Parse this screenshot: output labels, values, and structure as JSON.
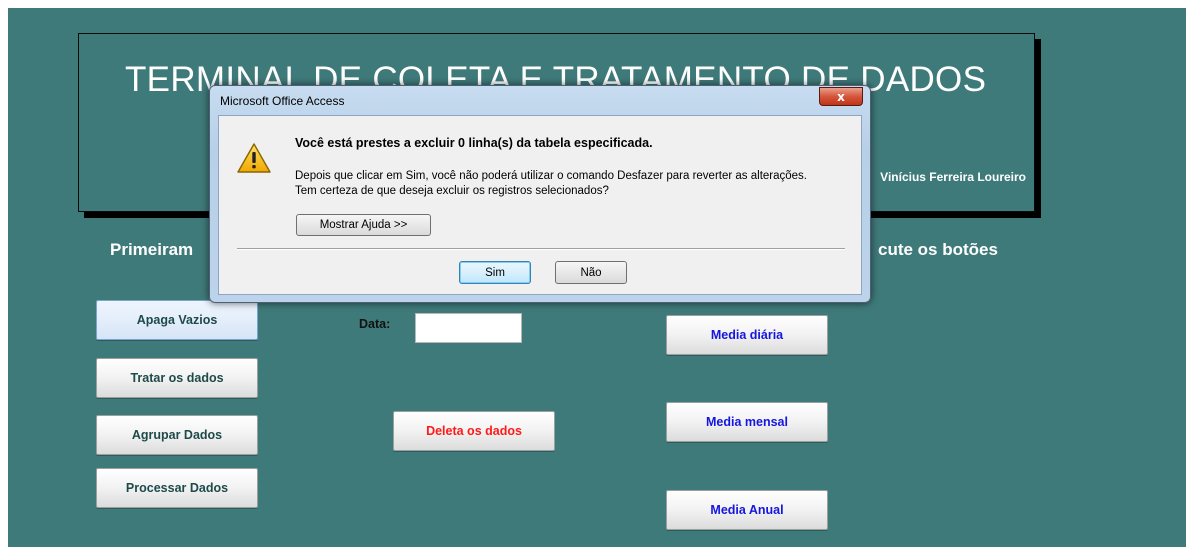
{
  "banner": {
    "title": "TERMINAL DE COLETA E TRATAMENTO DE DADOS",
    "author": "Vinícius Ferreira Loureiro"
  },
  "instructions": {
    "left": "Primeiram",
    "right": "cute os botões"
  },
  "form": {
    "data_label": "Data:",
    "data_value": ""
  },
  "buttons": {
    "apaga_vazios": "Apaga Vazios",
    "tratar_dados": "Tratar os dados",
    "agrupar_dados": "Agrupar Dados",
    "processar_dados": "Processar Dados",
    "deleta_dados": "Deleta os dados",
    "media_diaria": "Media diária",
    "media_mensal": "Media mensal",
    "media_anual": "Media Anual"
  },
  "dialog": {
    "title": "Microsoft Office Access",
    "close_label": "x",
    "heading": "Você está prestes a excluir 0 linha(s) da tabela especificada.",
    "line1": "Depois que clicar em Sim, você não poderá utilizar o comando Desfazer para reverter as alterações.",
    "line2": "Tem certeza de que deseja excluir os registros selecionados?",
    "help_button": "Mostrar Ajuda >>",
    "yes_button": "Sim",
    "no_button": "Não",
    "icon": "warning-icon"
  },
  "colors": {
    "background": "#3f7a7a",
    "button_text": "#1e4a4a",
    "media_text": "#1515e0",
    "delete_text": "#ff1a1a"
  }
}
